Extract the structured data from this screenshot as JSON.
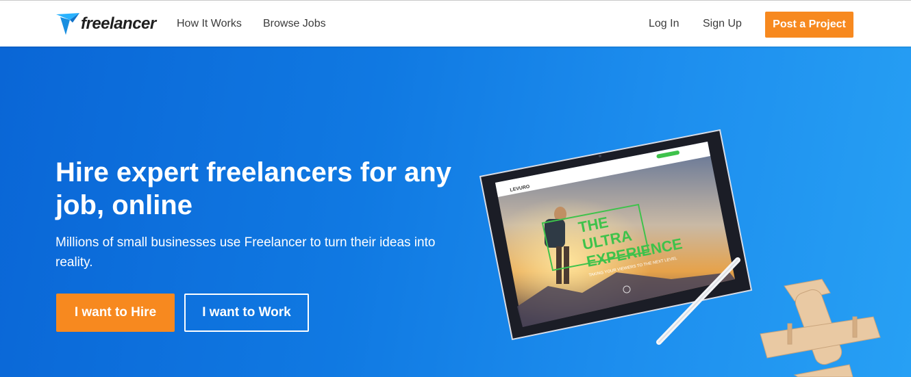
{
  "nav": {
    "logo_text": "freelancer",
    "how_it_works": "How It Works",
    "browse_jobs": "Browse Jobs",
    "log_in": "Log In",
    "sign_up": "Sign Up",
    "post_project": "Post a Project"
  },
  "hero": {
    "title": "Hire expert freelancers for any job, online",
    "subtitle": "Millions of small businesses use Freelancer to turn their ideas into reality.",
    "hire_button": "I want to Hire",
    "work_button": "I want to Work"
  },
  "tablet_screen": {
    "brand": "LEVURO",
    "headline_line1": "THE",
    "headline_line2": "ULTRA",
    "headline_line3": "EXPERIENCE",
    "tagline": "TAKING YOUR VIEWERS TO THE NEXT LEVEL"
  },
  "colors": {
    "accent_orange": "#f7891f",
    "hero_blue": "#1079e2",
    "screen_green": "#3ec24b"
  }
}
